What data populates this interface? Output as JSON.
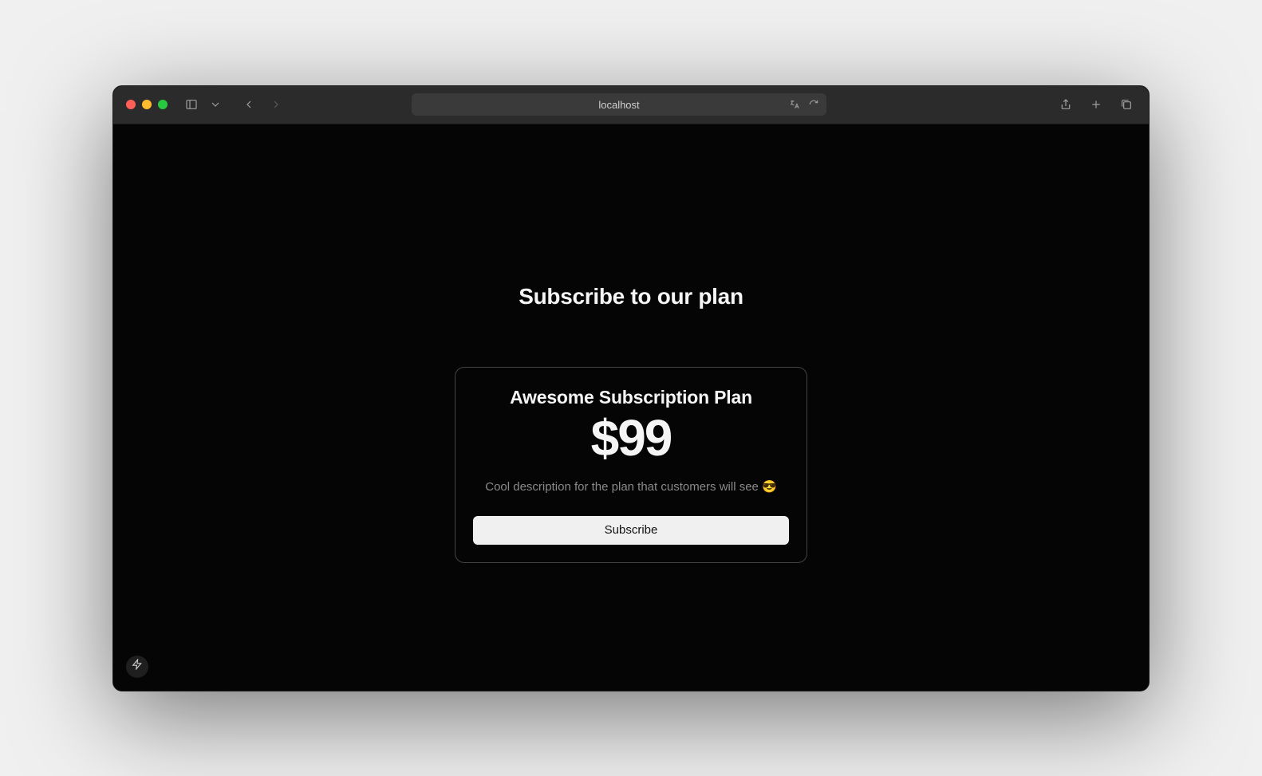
{
  "browser": {
    "address": "localhost"
  },
  "page": {
    "heading": "Subscribe to our plan"
  },
  "plan": {
    "title": "Awesome Subscription Plan",
    "price": "$99",
    "description": "Cool description for the plan that customers will see 😎",
    "button_label": "Subscribe"
  }
}
